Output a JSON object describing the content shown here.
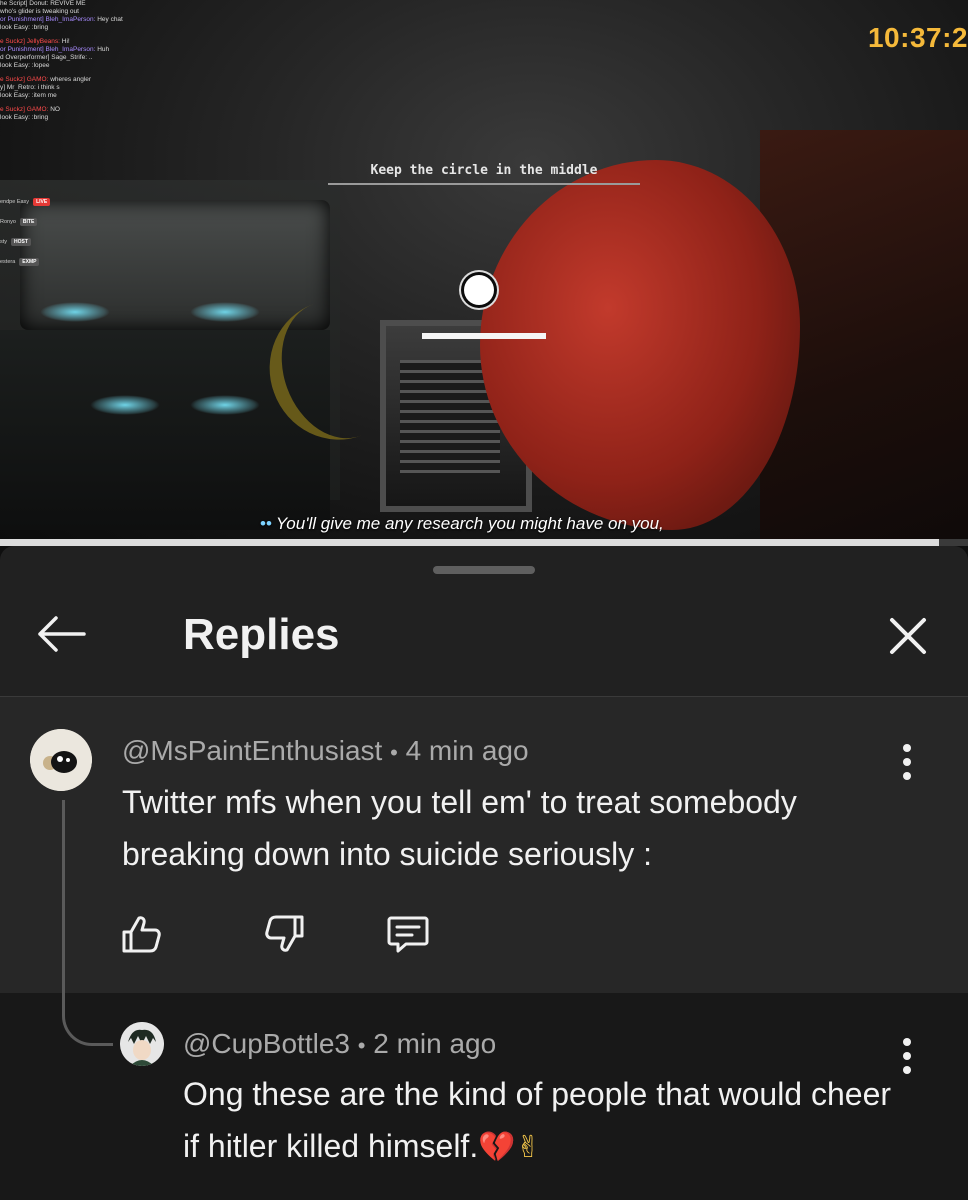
{
  "video": {
    "clock": "10:37:2",
    "hud_instruction": "Keep the circle in the middle",
    "subtitle": "You'll give me any research you might have on you,",
    "progress": 0.97,
    "chat_log": [
      {
        "name": "he Script] Donut:",
        "msg": "REVIVE ME",
        "color": "#d9d9d9"
      },
      {
        "name": "",
        "msg": "who's glider is tweaking out",
        "color": "#ff4b4b"
      },
      {
        "name": "or Punishment] Bleh_ImaPerson:",
        "msg": "Hey chat",
        "color": "#a88bff"
      },
      {
        "name": "look",
        "msg": "Easy: :bring",
        "color": "#d9d9d9"
      },
      {
        "name": "e Suckz] JellyBeans:",
        "msg": "Hi!",
        "color": "#ff4b4b"
      },
      {
        "name": "or Punishment] Bleh_ImaPerson:",
        "msg": "Huh",
        "color": "#a88bff"
      },
      {
        "name": "d Overperformer] Sage_Strife:",
        "msg": "..",
        "color": "#d9d9d9"
      },
      {
        "name": "look",
        "msg": "Easy: :lopee",
        "color": "#d9d9d9"
      },
      {
        "name": "e Suckz] GAMO:",
        "msg": "wheres angler",
        "color": "#ff4b4b"
      },
      {
        "name": "y] Mr_Retro:",
        "msg": "i think s",
        "color": "#d9d9d9"
      },
      {
        "name": "look",
        "msg": "Easy: :item me",
        "color": "#d9d9d9"
      },
      {
        "name": "e Suckz] GAMO:",
        "msg": "NO",
        "color": "#ff4b4b"
      },
      {
        "name": "look",
        "msg": "Easy: :bring",
        "color": "#d9d9d9"
      }
    ],
    "streamers": [
      {
        "name": "endpe Easy",
        "tag": "LIVE",
        "tag_color": "#e53935"
      },
      {
        "name": "Ronyo",
        "tag": "BITE",
        "tag_color": "#555555"
      },
      {
        "name": "sty",
        "tag": "HOST",
        "tag_color": "#555555"
      },
      {
        "name": "estera",
        "tag": "EXMP",
        "tag_color": "#555555"
      }
    ]
  },
  "panel": {
    "title": "Replies",
    "parent_comment": {
      "handle": "@MsPaintEnthusiast",
      "separator": "•",
      "time": "4 min ago",
      "text": "Twitter mfs when you tell em' to treat somebody breaking down into suicide seriously :"
    },
    "reply_comment": {
      "handle": "@CupBottle3",
      "separator": "•",
      "time": "2 min ago",
      "text": "Ong these are the kind of people that would cheer if hitler killed  himself.",
      "emoji_1": "💔",
      "emoji_2": "✌"
    }
  },
  "colors": {
    "panel_bg": "#212121",
    "parent_bg": "#272727",
    "reply_bg": "#181818",
    "text_primary": "#f1f1f1",
    "text_secondary": "#aaaaaa",
    "clock": "#f5b93a"
  },
  "icons": [
    "back-arrow-icon",
    "close-icon",
    "more-vert-icon",
    "thumbs-up-icon",
    "thumbs-down-icon",
    "reply-icon"
  ]
}
